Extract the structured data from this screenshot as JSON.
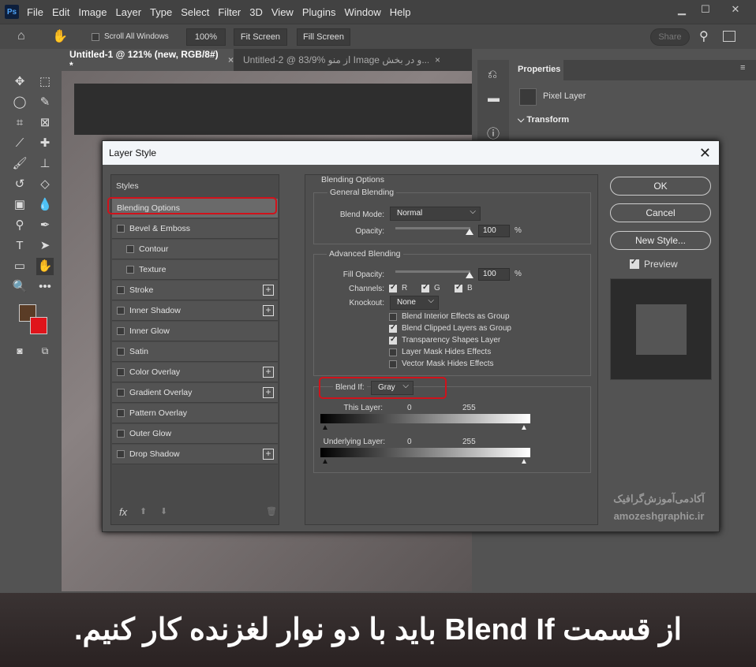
{
  "menu": {
    "app_icon": "Ps",
    "items": [
      "File",
      "Edit",
      "Image",
      "Layer",
      "Type",
      "Select",
      "Filter",
      "3D",
      "View",
      "Plugins",
      "Window",
      "Help"
    ]
  },
  "options": {
    "scroll_all": "Scroll All Windows",
    "zoom": "100%",
    "fit": "Fit Screen",
    "fill": "Fill Screen",
    "share": "Share"
  },
  "tabs": [
    {
      "label": "Untitled-1 @ 121% (new, RGB/8#) *"
    },
    {
      "label": "Untitled-2 @ 83/9% از منو Image و در بخش..."
    }
  ],
  "properties": {
    "title": "Properties",
    "layer_type": "Pixel Layer",
    "section": "Transform"
  },
  "dialog": {
    "title": "Layer Style",
    "styles_header": "Styles",
    "styles": [
      {
        "label": "Blending Options",
        "selected": true
      },
      {
        "label": "Bevel & Emboss",
        "checked": false
      },
      {
        "label": "Contour",
        "checked": false
      },
      {
        "label": "Texture",
        "checked": false
      },
      {
        "label": "Stroke",
        "checked": false,
        "plus": true
      },
      {
        "label": "Inner Shadow",
        "checked": false,
        "plus": true
      },
      {
        "label": "Inner Glow",
        "checked": false
      },
      {
        "label": "Satin",
        "checked": false
      },
      {
        "label": "Color Overlay",
        "checked": false,
        "plus": true
      },
      {
        "label": "Gradient Overlay",
        "checked": false,
        "plus": true
      },
      {
        "label": "Pattern Overlay",
        "checked": false
      },
      {
        "label": "Outer Glow",
        "checked": false
      },
      {
        "label": "Drop Shadow",
        "checked": false,
        "plus": true
      }
    ],
    "fx": "fx",
    "blending": {
      "title": "Blending Options",
      "general": "General Blending",
      "blend_mode_label": "Blend Mode:",
      "blend_mode": "Normal",
      "opacity_label": "Opacity:",
      "opacity": "100",
      "pct": "%",
      "advanced": "Advanced Blending",
      "fill_label": "Fill Opacity:",
      "fill": "100",
      "channels_label": "Channels:",
      "channels": [
        "R",
        "G",
        "B"
      ],
      "knockout_label": "Knockout:",
      "knockout": "None",
      "checks": [
        {
          "label": "Blend Interior Effects as Group",
          "checked": false
        },
        {
          "label": "Blend Clipped Layers as Group",
          "checked": true
        },
        {
          "label": "Transparency Shapes Layer",
          "checked": true
        },
        {
          "label": "Layer Mask Hides Effects",
          "checked": false
        },
        {
          "label": "Vector Mask Hides Effects",
          "checked": false
        }
      ],
      "blend_if_label": "Blend If:",
      "blend_if": "Gray",
      "this_layer": "This Layer:",
      "underlying": "Underlying Layer:",
      "min": "0",
      "max": "255"
    },
    "buttons": {
      "ok": "OK",
      "cancel": "Cancel",
      "new_style": "New Style...",
      "preview": "Preview"
    }
  },
  "watermark": {
    "fa": "آکادمی‌آموزش‌گرافیک",
    "url": "amozeshgraphic.ir"
  },
  "caption": "از قسمت Blend If باید با دو نوار لغزنده کار کنیم."
}
